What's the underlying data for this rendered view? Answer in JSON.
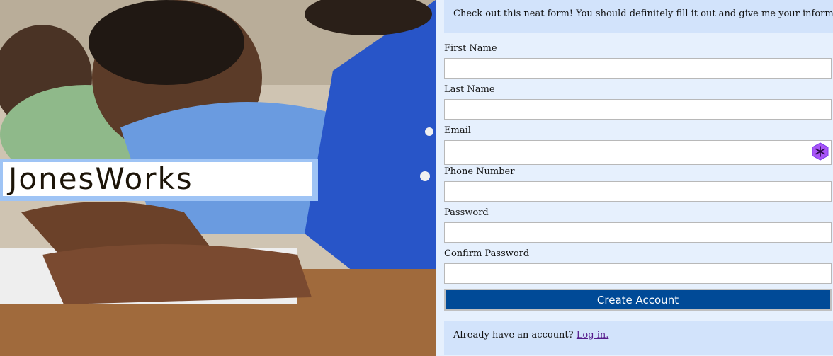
{
  "brand": {
    "logo_text": "JonesWorks"
  },
  "intro": {
    "text": "Check out this neat form! You should definitely fill it out and give me your information."
  },
  "fields": {
    "first_name": {
      "label": "First Name",
      "value": ""
    },
    "last_name": {
      "label": "Last Name",
      "value": ""
    },
    "email": {
      "label": "Email",
      "value": ""
    },
    "phone": {
      "label": "Phone Number",
      "value": ""
    },
    "password": {
      "label": "Password",
      "value": ""
    },
    "confirm_password": {
      "label": "Confirm Password",
      "value": ""
    }
  },
  "buttons": {
    "create_account": "Create Account"
  },
  "login": {
    "prompt": "Already have an account?",
    "link": "Log in."
  },
  "colors": {
    "button": "#004a97",
    "panel": "#d2e3fb",
    "background": "#e6f0fd",
    "logo_border": "#9fc4f5"
  }
}
